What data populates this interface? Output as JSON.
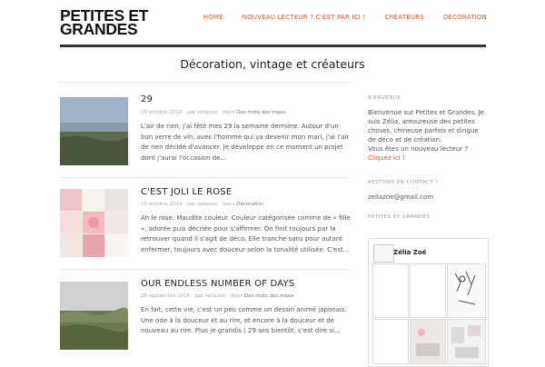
{
  "site": {
    "title_line1": "PETITES ET",
    "title_line2": "GRANDES"
  },
  "nav": {
    "items": [
      "HOME",
      "NOUVEAU LECTEUR ? C'EST PAR ICI !",
      "CRÉATEURS",
      "DECORATION"
    ]
  },
  "tagline": "Décoration, vintage et créateurs",
  "posts": [
    {
      "title": "29",
      "date": "19 octobre 2014",
      "by": "par zeliazoe",
      "in": "dans",
      "category": "Des mots des maux",
      "excerpt": "L'air de rien, j'ai fêté mes 29 la semaine dernière. Autour d'un bon verre de vin, avec l'homme qui va devenir mon mari, j'ai l'air de rien décidé d'avancer. Je développe en ce moment un projet dont j'aurai l'occasion de..."
    },
    {
      "title": "C'EST JOLI LE ROSE",
      "date": "15 octobre 2014",
      "by": "par zeliazoe",
      "in": "dans",
      "category": "Décoration",
      "excerpt": "Ah le rose. Maudite couleur. Couleur catégorisée comme de « fille », adorée puis décriée pour s'affirmer. On finit toujours par la retrouver quand il s'agit de déco. Elle tranche sans pour autant enfermer, toujours avec douceur selon la tonalité utilisée. C'est..."
    },
    {
      "title": "OUR ENDLESS NUMBER OF DAYS",
      "date": "26 septembre 2014",
      "by": "par zeliazoe",
      "in": "dans",
      "category": "Des mots des maux",
      "excerpt": "En fait, cette vie, c'est un peu comme un dessin animé japonais. Une ode à la douceur et au rire, et encore à la douceur et de nouveau au rire. Plus je grandis ( 29 ans bientôt, c'est dire si..."
    }
  ],
  "sidebar": {
    "welcome_heading": "BIENVENUE",
    "welcome_text": "Bienvenue sur Petites et Grandes. Je suis Zélia, amoureuse des petites choses, chineuse parfois et dingue de déco et de création.",
    "new_reader_text": "Vous êtes un nouveau lecteur ?",
    "new_reader_link": "Cliquez ici !",
    "contact_heading": "RESTONS EN CONTACT !",
    "email": "zeliazoe@gmail.com",
    "facebook_heading": "PETITES ET GRANDES",
    "facebook_name": "Zélia Zoé"
  }
}
